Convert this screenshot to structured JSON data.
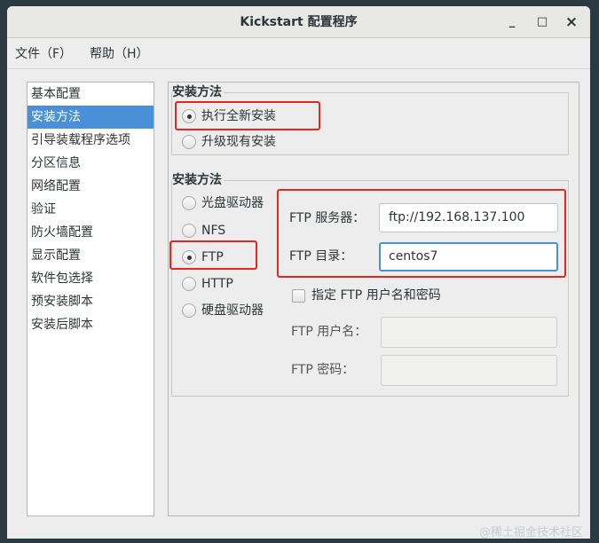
{
  "window": {
    "title": "Kickstart 配置程序",
    "minimize": "_",
    "maximize": "□",
    "close": "×"
  },
  "menu": {
    "file": "文件（F）",
    "help": "帮助（H）"
  },
  "sidebar": {
    "items": [
      {
        "label": "基本配置"
      },
      {
        "label": "安装方法",
        "selected": true
      },
      {
        "label": "引导装载程序选项"
      },
      {
        "label": "分区信息"
      },
      {
        "label": "网络配置"
      },
      {
        "label": "验证"
      },
      {
        "label": "防火墙配置"
      },
      {
        "label": "显示配置"
      },
      {
        "label": "软件包选择"
      },
      {
        "label": "预安装脚本"
      },
      {
        "label": "安装后脚本"
      }
    ]
  },
  "install_type": {
    "legend": "安装方法",
    "options": [
      {
        "label": "执行全新安装",
        "checked": true
      },
      {
        "label": "升级现有安装",
        "checked": false
      }
    ]
  },
  "install_method": {
    "legend": "安装方法",
    "options": [
      {
        "label": "光盘驱动器",
        "checked": false
      },
      {
        "label": "NFS",
        "checked": false
      },
      {
        "label": "FTP",
        "checked": true
      },
      {
        "label": "HTTP",
        "checked": false
      },
      {
        "label": "硬盘驱动器",
        "checked": false
      }
    ],
    "ftp_server_label": "FTP 服务器：",
    "ftp_server_value": "ftp://192.168.137.100",
    "ftp_dir_label": "FTP 目录：",
    "ftp_dir_value": "centos7",
    "specify_user_label": "指定  FTP 用户名和密码",
    "ftp_user_label": "FTP 用户名：",
    "ftp_user_value": "",
    "ftp_pass_label": "FTP 密码：",
    "ftp_pass_value": ""
  },
  "watermark": "@稀土掘金技术社区",
  "colors": {
    "accent": "#4a90d9",
    "highlight": "#e8261f"
  }
}
